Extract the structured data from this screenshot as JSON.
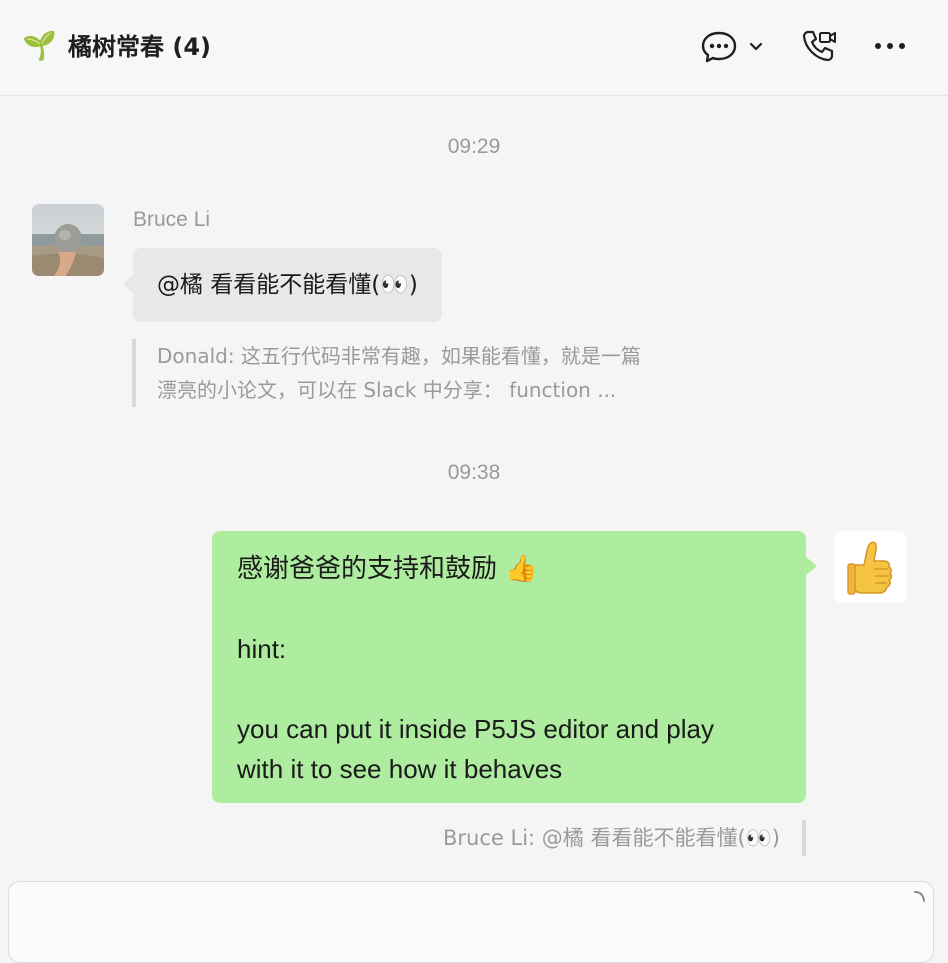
{
  "header": {
    "chat_emoji": "🌱",
    "chat_title": "橘树常春 (4)"
  },
  "messages": {
    "ts1": "09:29",
    "incoming": {
      "sender": "Bruce Li",
      "text": "@橘 看看能不能看懂(👀)",
      "quote_line1": "Donald: 这五行代码非常有趣，如果能看懂，就是一篇",
      "quote_line2": "漂亮的小论文，可以在 Slack 中分享：       function ..."
    },
    "ts2": "09:38",
    "outgoing": {
      "line1": "感谢爸爸的支持和鼓励 👍",
      "line2": "hint:",
      "line3": "you can put it inside P5JS editor and play",
      "line4": "with it to see how it behaves",
      "quote": "Bruce Li: @橘 看看能不能看懂(👀)"
    }
  },
  "icons": {
    "chat": "chat-bubble-icon",
    "dropdown": "chevron-down-icon",
    "call": "phone-video-icon",
    "more": "more-icon",
    "avatar_out": "thumbs-up-icon"
  }
}
